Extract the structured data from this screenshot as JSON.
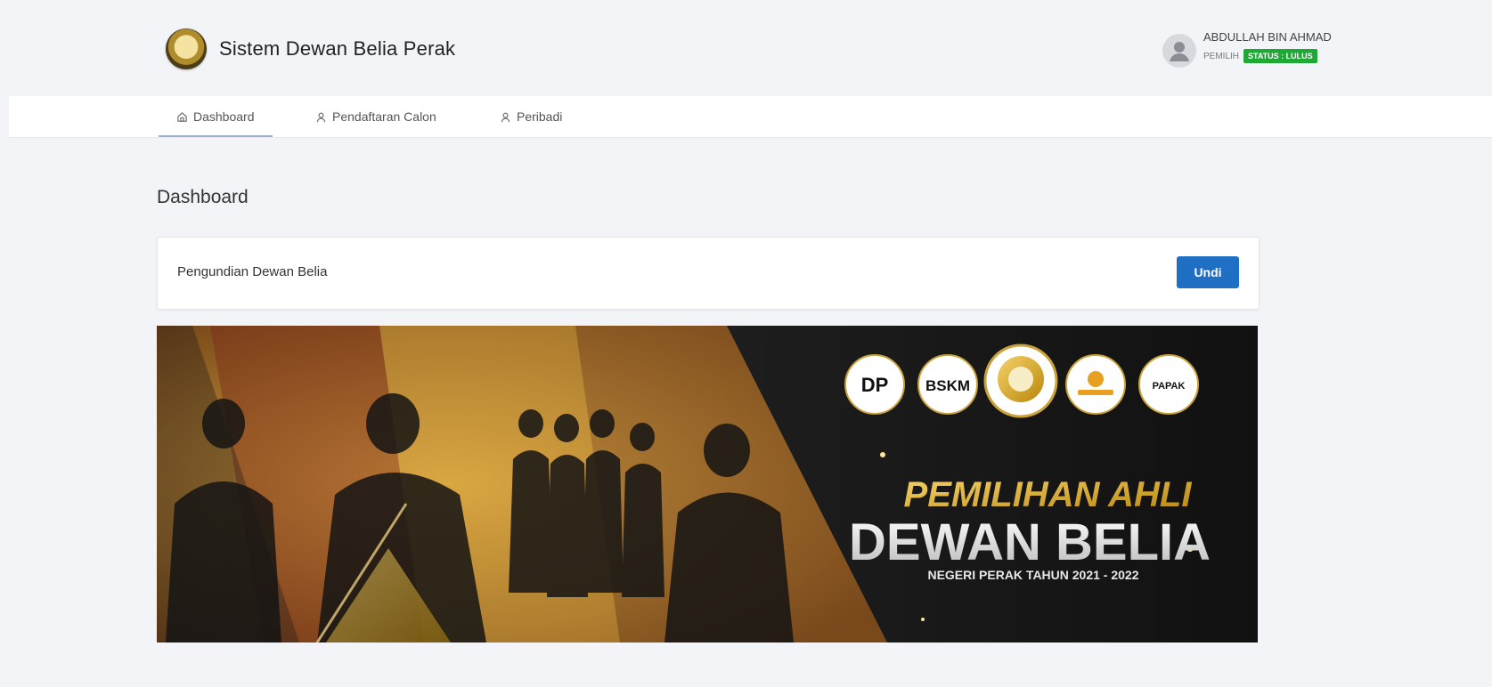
{
  "header": {
    "app_title": "Sistem Dewan Belia Perak",
    "user": {
      "name": "ABDULLAH BIN AHMAD",
      "role": "PEMILIH",
      "status": "STATUS : LULUS"
    }
  },
  "nav": {
    "items": [
      {
        "label": "Dashboard",
        "icon": "home-icon",
        "active": true
      },
      {
        "label": "Pendaftaran Calon",
        "icon": "user-icon",
        "active": false
      },
      {
        "label": "Peribadi",
        "icon": "user-icon",
        "active": false
      }
    ]
  },
  "main": {
    "page_title": "Dashboard",
    "card": {
      "title": "Pengundian Dewan Belia",
      "button_label": "Undi"
    },
    "banner": {
      "logos": [
        "DP",
        "BSKM",
        "PAPAK"
      ],
      "heading_line1": "PEMILIHAN AHLI",
      "heading_line2": "DEWAN BELIA",
      "subheading": "NEGERI PERAK TAHUN 2021 - 2022"
    }
  },
  "colors": {
    "primary_button": "#1f6fc5",
    "status_badge": "#1ea834",
    "banner_gold": "#f2b824"
  }
}
